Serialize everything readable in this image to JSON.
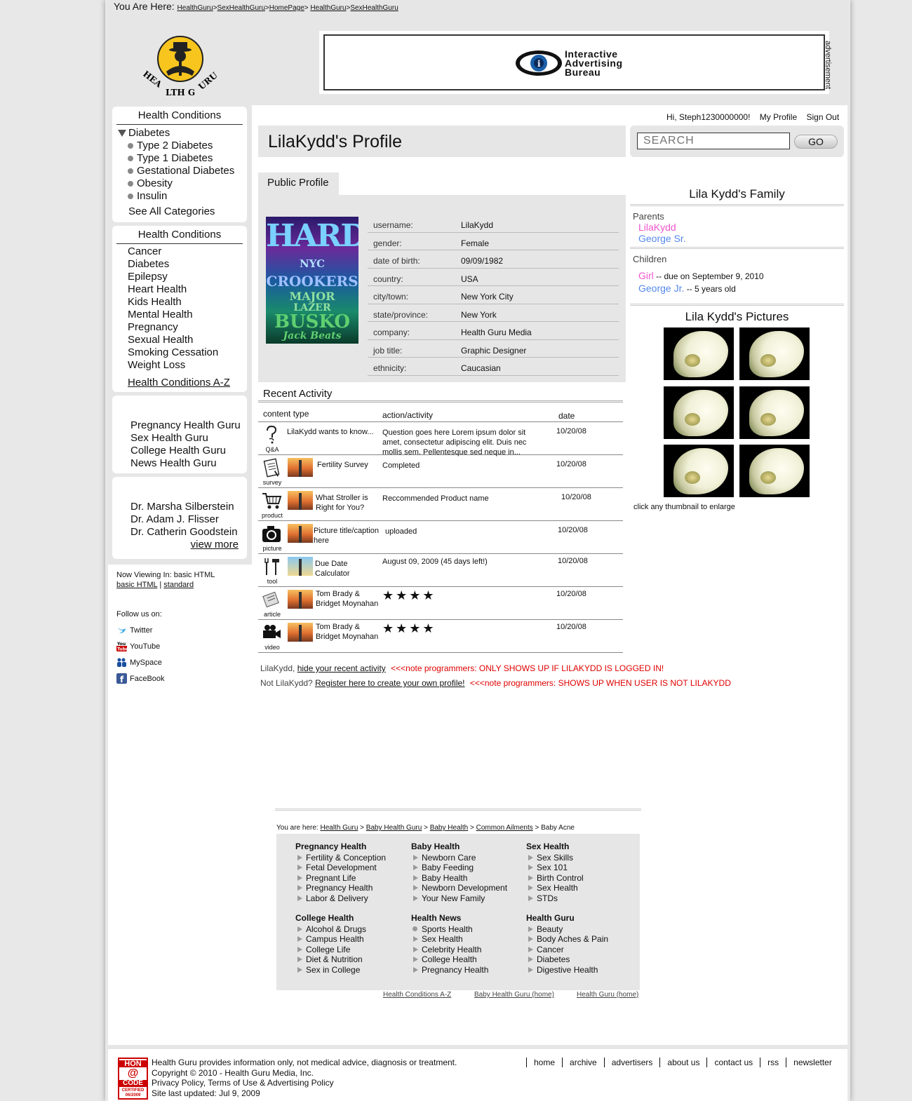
{
  "breadcrumb_top": {
    "label": "You Are Here:",
    "items": [
      "HealthGuru",
      "SexHealthGuru",
      "HomePage",
      "HealthGuru",
      "SexHealthGuru"
    ]
  },
  "logo_text": "HEALTH GURU",
  "ad": {
    "label": "advertisement",
    "iab_lines": [
      "Interactive",
      "Advertising",
      "Bureau"
    ]
  },
  "header": {
    "greeting": "Hi, Steph1230000000!",
    "my_profile": "My Profile",
    "sign_out": "Sign Out",
    "search_placeholder": "SEARCH",
    "go_label": "GO"
  },
  "sidebar": {
    "box1_title": "Health Conditions",
    "expanded": "Diabetes",
    "sub_items": [
      "Type 2 Diabetes",
      "Type 1 Diabetes",
      "Gestational Diabetes",
      "Obesity",
      "Insulin"
    ],
    "see_all": "See All Categories",
    "box2_title": "Health Conditions",
    "conditions": [
      "Cancer",
      "Diabetes",
      "Epilepsy",
      "Heart Health",
      "Kids Health",
      "Mental Health",
      "Pregnancy",
      "Sexual Health",
      "Smoking Cessation",
      "Weight Loss"
    ],
    "az_link": "Health Conditions A-Z",
    "gurus": [
      "Pregnancy Health Guru",
      "Sex Health Guru",
      "College Health Guru",
      "News Health Guru"
    ],
    "doctors": [
      "Dr. Marsha Silberstein",
      "Dr. Adam J. Flisser",
      "Dr. Catherin Goodstein"
    ],
    "view_more": "view more",
    "now_viewing": "Now Viewing In:  basic HTML",
    "mode_basic": "basic HTML",
    "mode_standard": "standard",
    "follow_label": "Follow us on:",
    "social": [
      "Twitter",
      "YouTube",
      "MySpace",
      "FaceBook"
    ]
  },
  "profile": {
    "title": "LilaKydd's Profile",
    "tab": "Public Profile",
    "poster_lines": [
      "HARD",
      "NYC",
      "CROOKERS",
      "MAJOR",
      "LAZER",
      "BUSKO",
      "Jack Beats"
    ],
    "fields": [
      {
        "k": "username:",
        "v": "LilaKydd"
      },
      {
        "k": "gender:",
        "v": "Female"
      },
      {
        "k": "date of birth:",
        "v": "09/09/1982"
      },
      {
        "k": "country:",
        "v": "USA"
      },
      {
        "k": "city/town:",
        "v": "New York City"
      },
      {
        "k": "state/province:",
        "v": "New York"
      },
      {
        "k": "company:",
        "v": "Health Guru Media"
      },
      {
        "k": "job title:",
        "v": "Graphic Designer"
      },
      {
        "k": "ethnicity:",
        "v": "Caucasian"
      }
    ]
  },
  "family": {
    "title": "Lila Kydd's Family",
    "parents_label": "Parents",
    "parents": [
      "LilaKydd",
      "George Sr."
    ],
    "children_label": "Children",
    "child1_name": "Girl",
    "child1_note": "-- due on September 9, 2010",
    "child2_name": "George Jr.",
    "child2_note": "-- 5 years old",
    "color_pink": "#ee55cc",
    "color_blue": "#5588ee"
  },
  "pictures": {
    "title": "Lila Kydd's Pictures",
    "hint": "click any thumbnail to enlarge"
  },
  "recent": {
    "title": "Recent Activity",
    "col_type": "content type",
    "col_action": "action/activity",
    "col_date": "date",
    "rows": [
      {
        "cap": "Q&A",
        "title": "LilaKydd wants to know...",
        "action": "Question goes here Lorem ipsum dolor sit amet, consectetur adipiscing elit. Duis nec mollis sem. Pellentesque sed neque in...",
        "date": "10/20/08"
      },
      {
        "cap": "survey",
        "title": "Fertility Survey",
        "action": "Completed",
        "date": "10/20/08"
      },
      {
        "cap": "product",
        "title": "What Stroller is Right for You?",
        "action": "Reccommended Product name",
        "date": "10/20/08"
      },
      {
        "cap": "picture",
        "title": "Picture title/caption here",
        "action": "uploaded",
        "date": "10/20/08"
      },
      {
        "cap": "tool",
        "title": "Due Date Calculator",
        "action": "August 09, 2009 (45 days left!)",
        "date": "10/20/08"
      },
      {
        "cap": "article",
        "title": "Tom Brady & Bridget Moynahan",
        "stars": "★★★★",
        "date": "10/20/08"
      },
      {
        "cap": "video",
        "title": "Tom Brady & Bridget Moynahan",
        "stars": "★★★★",
        "date": "10/20/08"
      }
    ]
  },
  "notes": {
    "line1_prefix": "LilaKydd,",
    "line1_link": "hide your recent activity",
    "line1_note": "<<<note programmers: ONLY SHOWS UP IF LILAKYDD IS LOGGED IN!",
    "line2_prefix": "Not LilaKydd?",
    "line2_link": "Register here to create your own profile!",
    "line2_note": "<<<note programmers: SHOWS UP WHEN USER IS NOT LILAKYDD"
  },
  "footer_crumbs": {
    "label": "You are here:",
    "items": [
      "Health Guru",
      "Baby Health Guru",
      "Baby Health",
      "Common Ailments"
    ],
    "current": "Baby Acne"
  },
  "sitemap": [
    {
      "h": "Pregnancy Health",
      "items": [
        "Fertility & Conception",
        "Fetal Development",
        "Pregnant Life",
        "Pregnancy Health",
        "Labor & Delivery"
      ]
    },
    {
      "h": "Baby Health",
      "items": [
        "Newborn Care",
        "Baby Feeding",
        "Baby Health",
        "Newborn Development",
        "Your New Family"
      ]
    },
    {
      "h": "Sex Health",
      "items": [
        "Sex Skills",
        "Sex 101",
        "Birth Control",
        "Sex Health",
        "STDs"
      ]
    },
    {
      "h": "College Health",
      "items": [
        "Alcohol & Drugs",
        "Campus Health",
        "College Life",
        "Diet & Nutrition",
        "Sex in College"
      ]
    },
    {
      "h": "Health News",
      "items": [
        "Sports Health",
        "Sex Health",
        "Celebrity Health",
        "College Health",
        "Pregnancy Health"
      ]
    },
    {
      "h": "Health Guru",
      "items": [
        "Beauty",
        "Body Aches & Pain",
        "Cancer",
        "Diabetes",
        "Digestive Health"
      ]
    }
  ],
  "sitemap_links": [
    "Health Conditions A-Z",
    "Baby Health Guru (home)",
    "Health Guru (home)"
  ],
  "footer": {
    "hon_top": "HON",
    "hon_mid": "CODE",
    "hon_bottom": "CERTIFIED 06/2009",
    "lines": [
      "Health Guru provides information only, not medical advice, diagnosis or treatment.",
      "Copyright © 2010 - Health Guru Media, Inc.",
      "Privacy Policy, Terms of Use & Advertising Policy",
      "Site last updated: Jul 9, 2009"
    ],
    "nav": [
      "home",
      "archive",
      "advertisers",
      "about us",
      "contact us",
      "rss",
      "newsletter"
    ]
  }
}
